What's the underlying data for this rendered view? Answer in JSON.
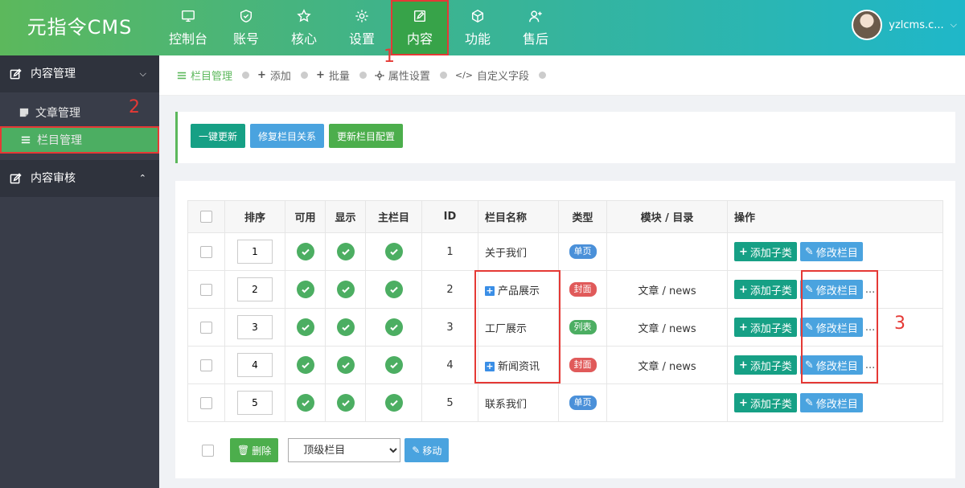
{
  "app": {
    "logo": "元指令CMS"
  },
  "topnav": [
    {
      "label": "控制台",
      "icon": "monitor-icon"
    },
    {
      "label": "账号",
      "icon": "shield-icon"
    },
    {
      "label": "核心",
      "icon": "star-icon"
    },
    {
      "label": "设置",
      "icon": "gear-icon"
    },
    {
      "label": "内容",
      "icon": "edit-icon",
      "active": true
    },
    {
      "label": "功能",
      "icon": "cube-icon"
    },
    {
      "label": "售后",
      "icon": "user-plus-icon"
    }
  ],
  "user": {
    "name": "yzlcms.c..."
  },
  "sidebar": {
    "group1": "内容管理",
    "items": [
      "文章管理",
      "栏目管理"
    ],
    "group2": "内容审核"
  },
  "breadcrumbs": [
    "栏目管理",
    "添加",
    "批量",
    "属性设置",
    "自定义字段"
  ],
  "actions": {
    "refresh": "一键更新",
    "repair": "修复栏目关系",
    "update_config": "更新栏目配置"
  },
  "table": {
    "headers": [
      "排序",
      "可用",
      "显示",
      "主栏目",
      "ID",
      "栏目名称",
      "类型",
      "模块 / 目录",
      "操作"
    ],
    "rows": [
      {
        "sort": "1",
        "id": "1",
        "name": "关于我们",
        "type": "单页",
        "module": "",
        "expand": false,
        "more": false
      },
      {
        "sort": "2",
        "id": "2",
        "name": "产品展示",
        "type": "封面",
        "module": "文章 / news",
        "expand": true,
        "more": true
      },
      {
        "sort": "3",
        "id": "3",
        "name": "工厂展示",
        "type": "列表",
        "module": "文章 / news",
        "expand": false,
        "more": true
      },
      {
        "sort": "4",
        "id": "4",
        "name": "新闻资讯",
        "type": "封面",
        "module": "文章 / news",
        "expand": true,
        "more": true
      },
      {
        "sort": "5",
        "id": "5",
        "name": "联系我们",
        "type": "单页",
        "module": "",
        "expand": false,
        "more": false
      }
    ],
    "add_child": "添加子类",
    "edit": "修改栏目",
    "more": "..."
  },
  "bottom": {
    "delete": "删除",
    "select_value": "顶级栏目",
    "move": "移动"
  },
  "annotations": [
    "1",
    "2",
    "3"
  ],
  "colors": {
    "primary": "#5cb85c",
    "teal": "#16a085",
    "blue": "#4aa3df",
    "danger": "#e53935"
  }
}
